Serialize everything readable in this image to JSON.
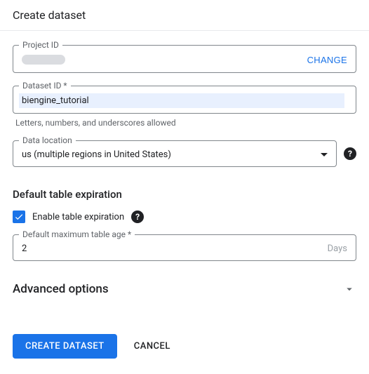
{
  "title": "Create dataset",
  "project": {
    "label": "Project ID",
    "change_label": "CHANGE"
  },
  "dataset": {
    "label": "Dataset ID *",
    "value": "biengine_tutorial",
    "helper": "Letters, numbers, and underscores allowed"
  },
  "location": {
    "label": "Data location",
    "value": "us (multiple regions in United States)"
  },
  "expiration": {
    "section_title": "Default table expiration",
    "checkbox_label": "Enable table expiration",
    "checked": true,
    "age_label": "Default maximum table age *",
    "age_value": "2",
    "age_unit": "Days"
  },
  "advanced": {
    "title": "Advanced options"
  },
  "actions": {
    "primary": "CREATE DATASET",
    "secondary": "CANCEL"
  }
}
